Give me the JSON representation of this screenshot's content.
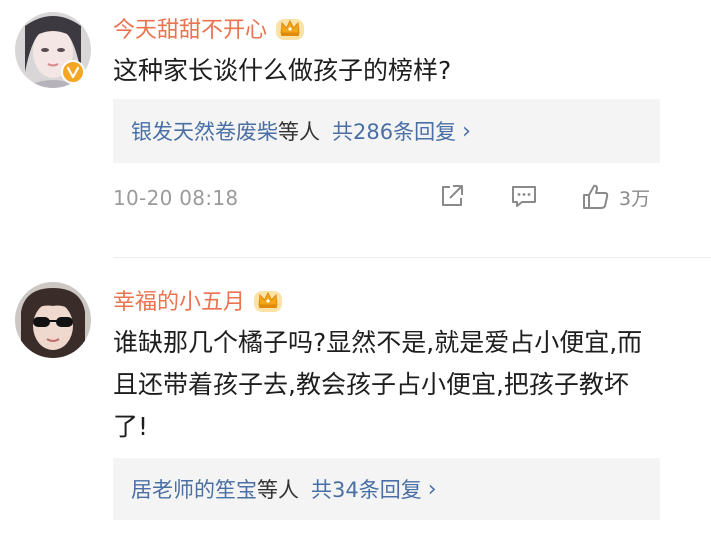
{
  "comments": [
    {
      "username": "今天甜甜不开心",
      "text": "这种家长谈什么做孩子的榜样?",
      "reply_names": "银发天然卷废柴",
      "reply_mid": "等人",
      "reply_count": "共286条回复",
      "reply_chevron": "›",
      "timestamp": "10-20 08:18",
      "like_count": "3万",
      "verified": true
    },
    {
      "username": "幸福的小五月",
      "text": "谁缺那几个橘子吗?显然不是,就是爱占小便宜,而且还带着孩子去,教会孩子占小便宜,把孩子教坏了!",
      "reply_names": "居老师的笙宝",
      "reply_mid": "等人",
      "reply_count": "共34条回复",
      "reply_chevron": "›"
    }
  ],
  "icons": {
    "crown": "crown-icon",
    "share": "share-icon",
    "comment": "comment-icon",
    "like": "thumbs-up-icon",
    "verified": "verified-v-icon"
  },
  "colors": {
    "username": "#eb7350",
    "link": "#4a6fa5",
    "reply_bg": "#f4f4f4",
    "meta": "#9b9b9b",
    "crown": "#f2a516",
    "verified": "#f5a623"
  }
}
